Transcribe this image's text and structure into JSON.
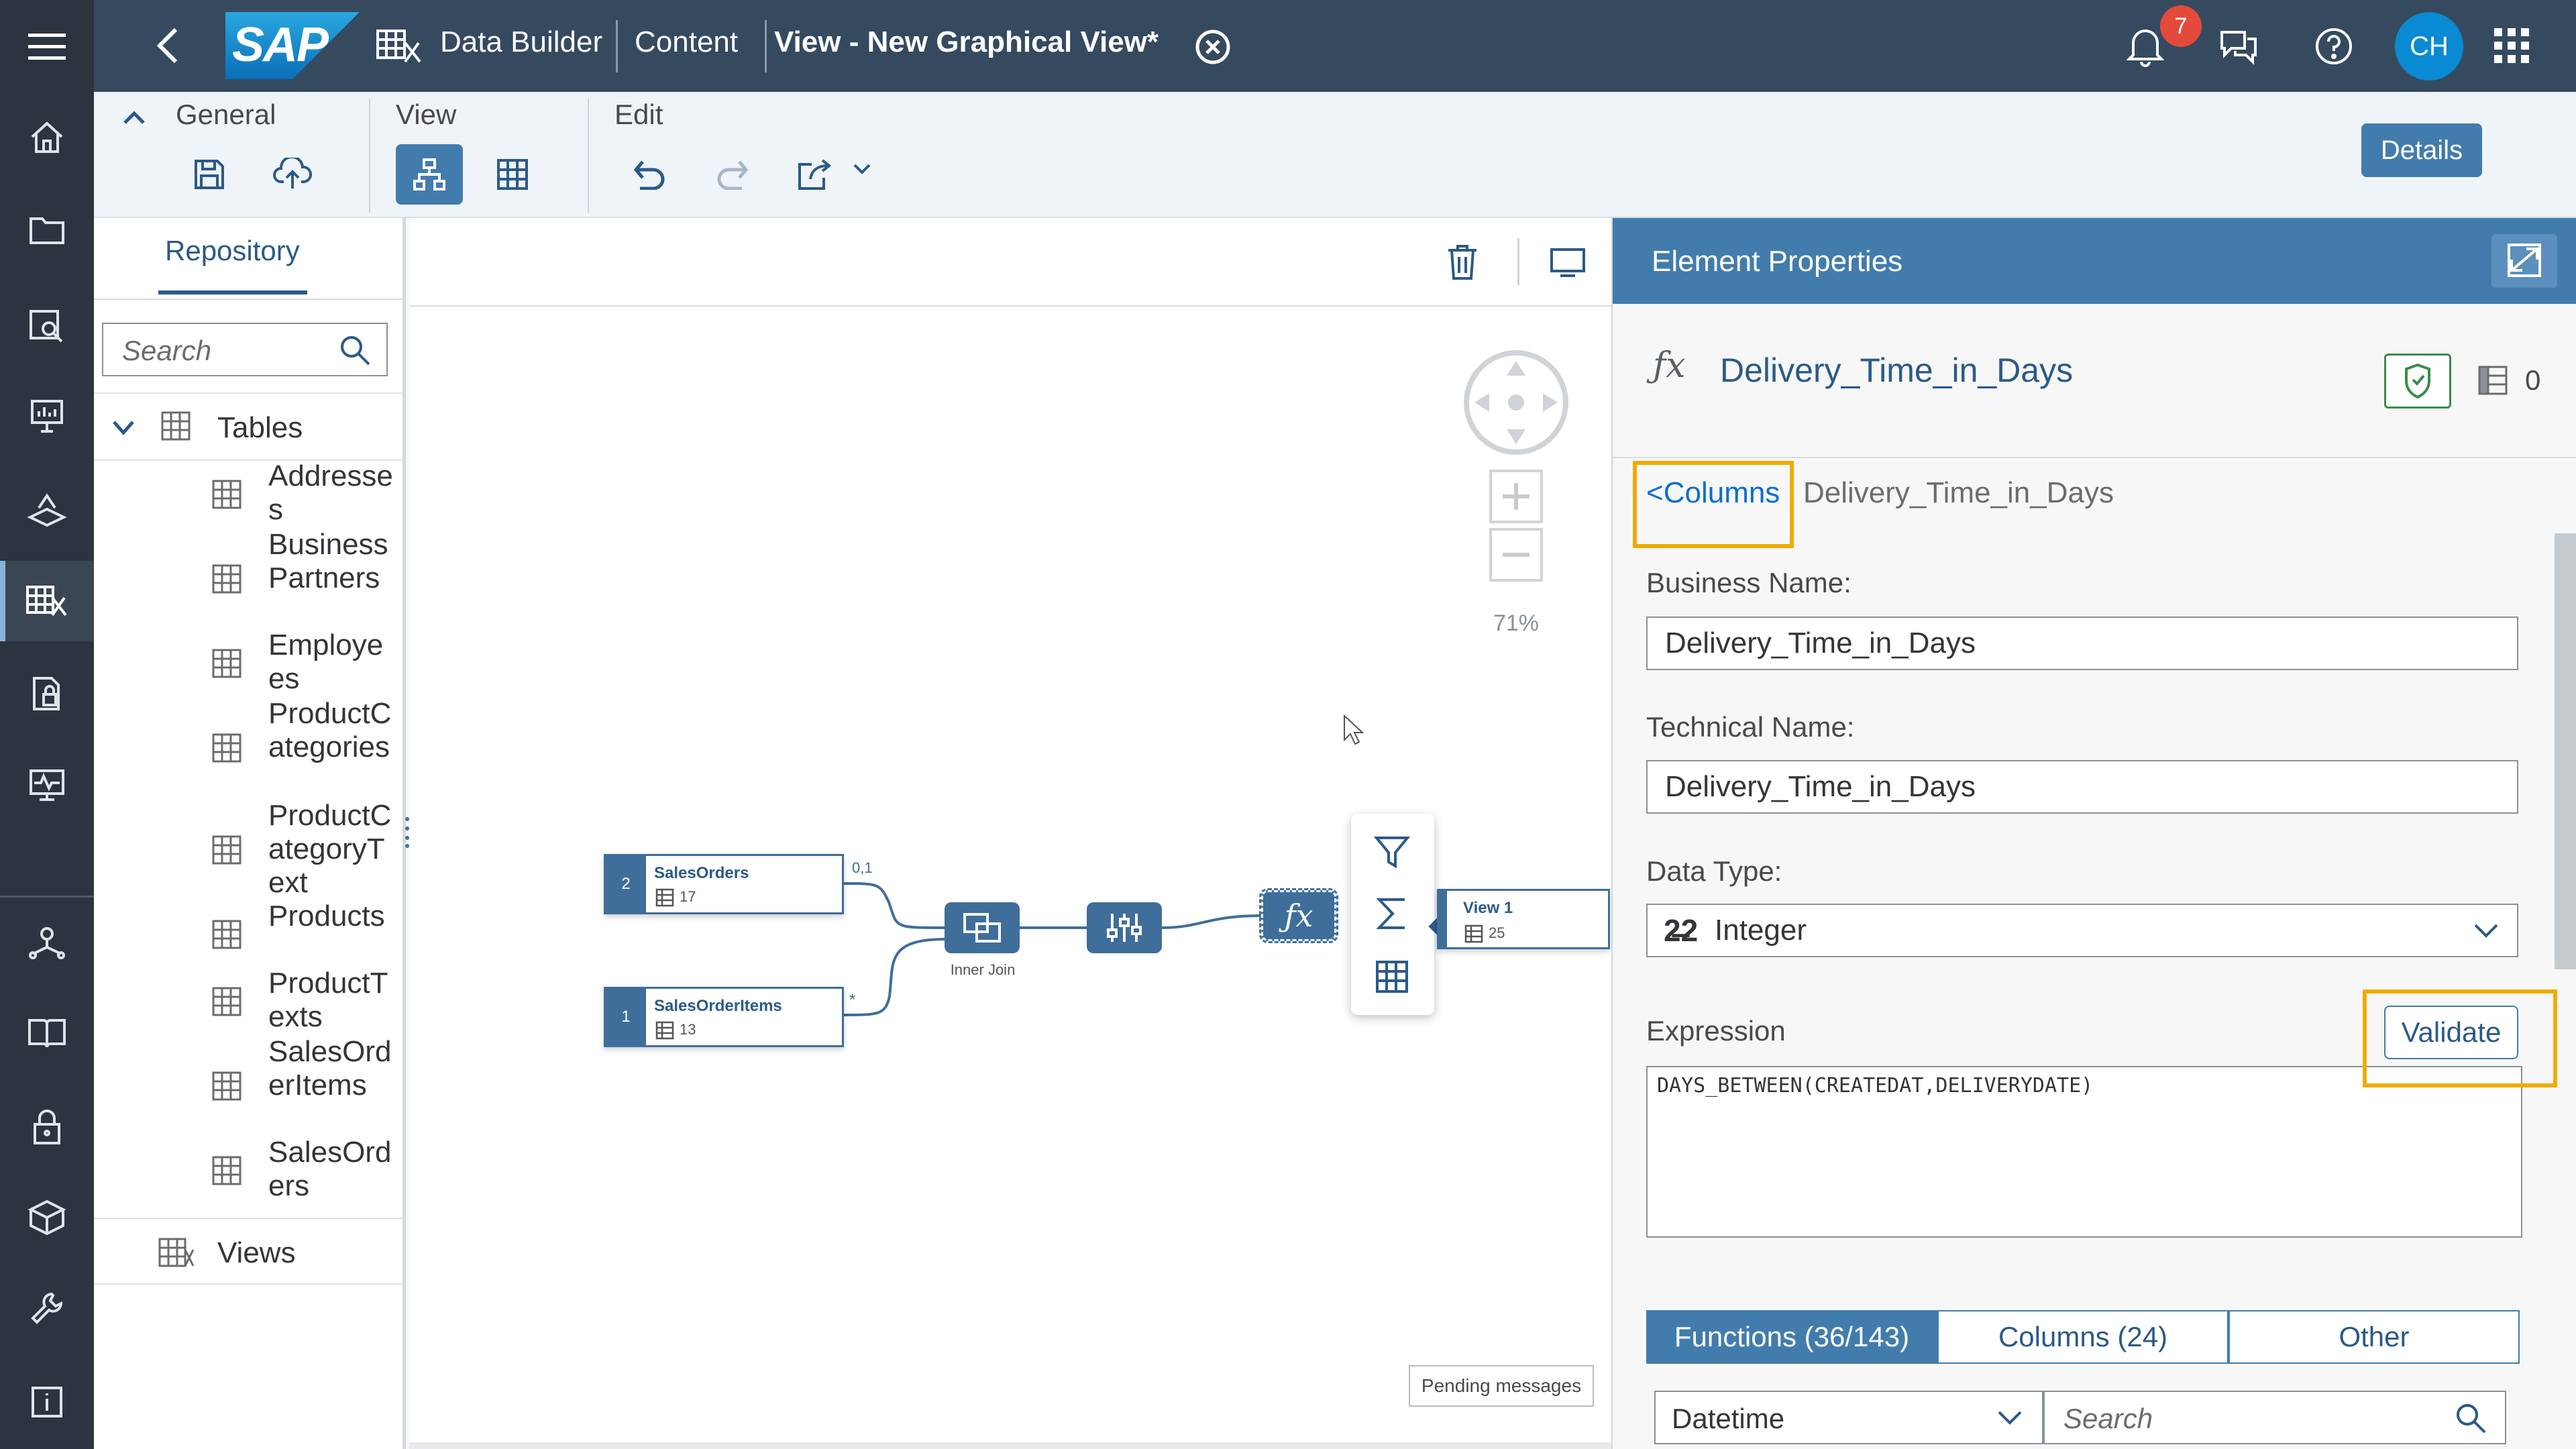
{
  "shell": {
    "logo": "SAP",
    "app_title": "Data Builder",
    "content_label": "Content",
    "view_title": "View - New Graphical View*",
    "notification_count": "7",
    "avatar_initials": "CH"
  },
  "toolbar": {
    "general_label": "General",
    "view_label": "View",
    "edit_label": "Edit",
    "details_button": "Details"
  },
  "repository": {
    "tab_label": "Repository",
    "search_placeholder": "Search",
    "tables_label": "Tables",
    "tables": [
      "Addresses",
      "BusinessPartners",
      "Employees",
      "ProductCategories",
      "ProductCategoryText",
      "Products",
      "ProductTexts",
      "SalesOrderItems",
      "SalesOrders"
    ],
    "views_label": "Views"
  },
  "canvas": {
    "zoom": "71%",
    "nodes": {
      "sales_orders": {
        "num": "2",
        "name": "SalesOrders",
        "count": "17"
      },
      "sales_order_items": {
        "num": "1",
        "name": "SalesOrderItems",
        "count": "13"
      },
      "view1": {
        "name": "View 1",
        "count": "25"
      }
    },
    "join_label": "Inner Join",
    "card_01": "0,1",
    "card_star": "*",
    "pending_messages": "Pending messages"
  },
  "properties": {
    "header": "Element Properties",
    "element_name": "Delivery_Time_in_Days",
    "columns_count": "0",
    "breadcrumb_back": "<Columns",
    "breadcrumb_current": "Delivery_Time_in_Days",
    "business_name_label": "Business Name:",
    "business_name_value": "Delivery_Time_in_Days",
    "technical_name_label": "Technical Name:",
    "technical_name_value": "Delivery_Time_in_Days",
    "data_type_label": "Data Type:",
    "data_type_value": "Integer",
    "expression_label": "Expression",
    "validate_button": "Validate",
    "expression_value": "DAYS_BETWEEN(CREATEDAT,DELIVERYDATE)",
    "tabs": {
      "functions": "Functions (36/143)",
      "columns": "Columns (24)",
      "other": "Other"
    },
    "category_value": "Datetime",
    "search_placeholder": "Search"
  },
  "colors": {
    "shell": "#354a5f",
    "rail": "#2c3440",
    "accent": "#427cac",
    "highlight": "#f0ab00",
    "badge": "#e34a3c"
  }
}
